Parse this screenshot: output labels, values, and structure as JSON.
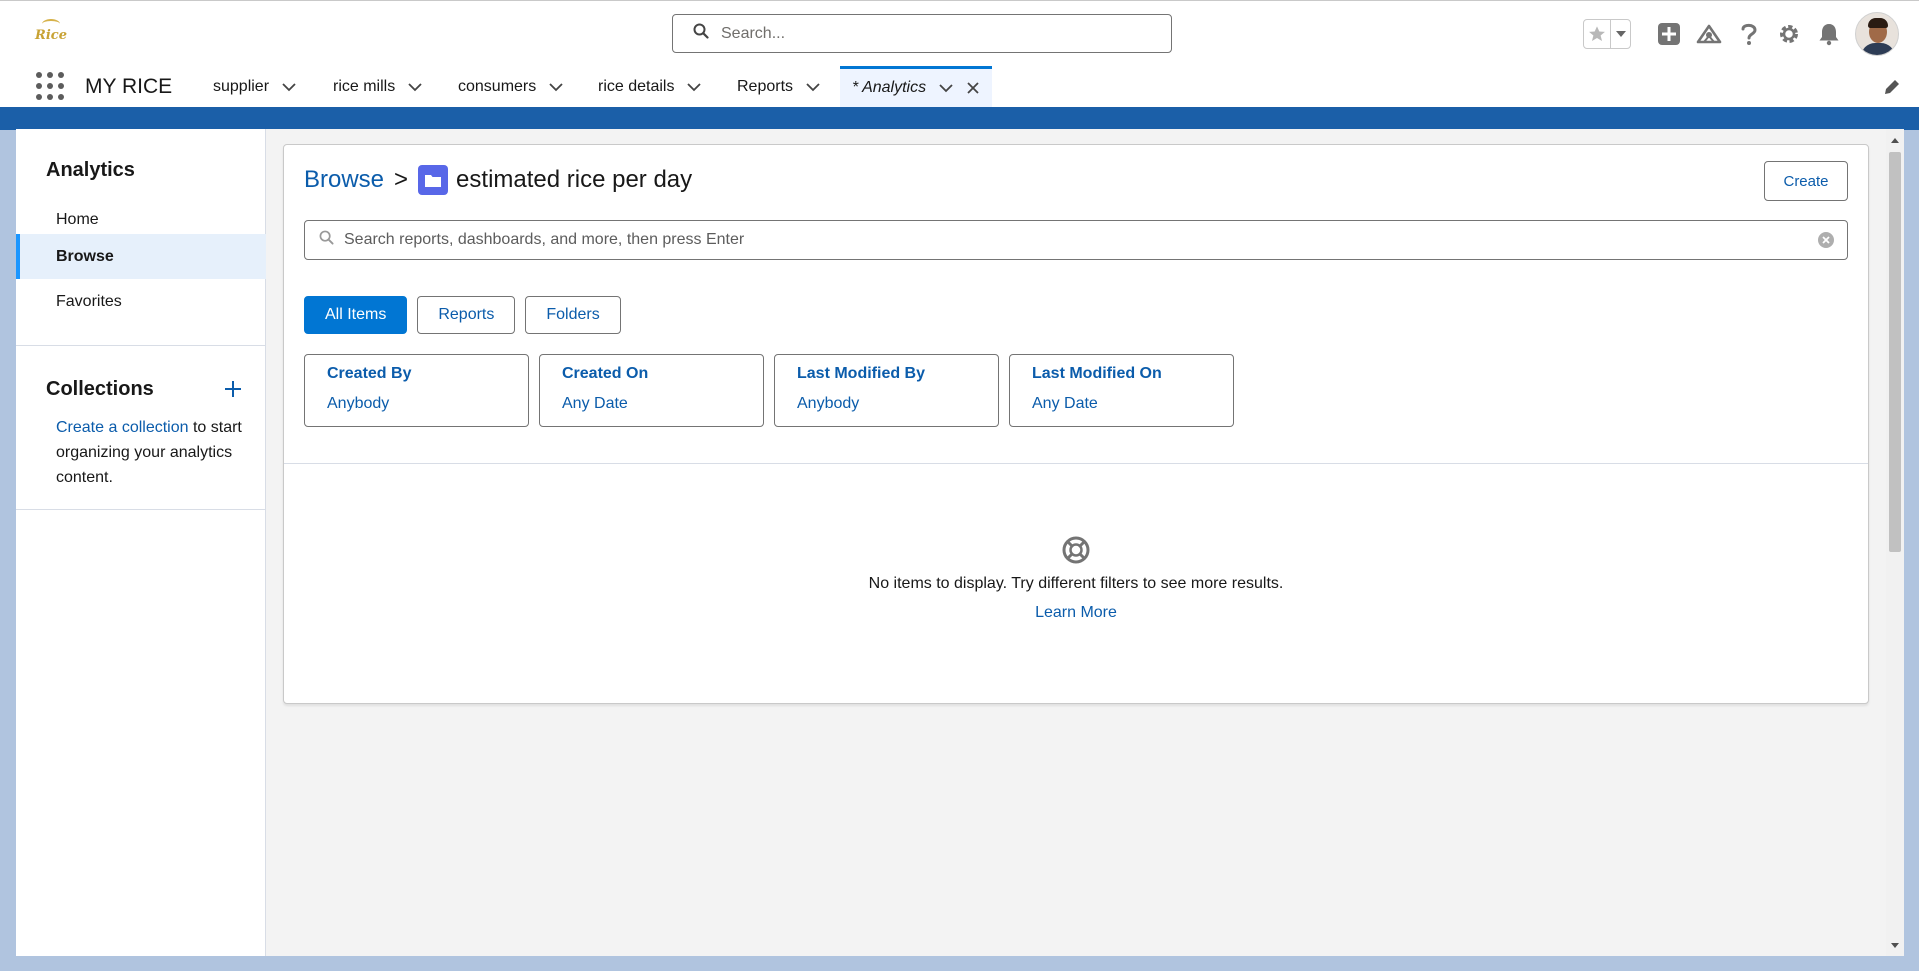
{
  "header": {
    "logo_text": "Rice",
    "search_placeholder": "Search..."
  },
  "navbar": {
    "app_name": "MY RICE",
    "items": [
      {
        "label": "supplier"
      },
      {
        "label": "rice mills"
      },
      {
        "label": "consumers"
      },
      {
        "label": "rice details"
      },
      {
        "label": "Reports"
      }
    ],
    "active_tab": "* Analytics"
  },
  "sidebar": {
    "title": "Analytics",
    "items": [
      {
        "label": "Home"
      },
      {
        "label": "Browse"
      },
      {
        "label": "Favorites"
      }
    ],
    "collections_title": "Collections",
    "collections_link": "Create a collection",
    "collections_text": " to start organizing your analytics content."
  },
  "main": {
    "breadcrumb_root": "Browse",
    "breadcrumb_sep": ">",
    "folder_name": "estimated rice per day",
    "create_label": "Create",
    "search_placeholder": "Search reports, dashboards, and more, then press Enter",
    "tabs": [
      {
        "label": "All Items"
      },
      {
        "label": "Reports"
      },
      {
        "label": "Folders"
      }
    ],
    "filters": [
      {
        "title": "Created By",
        "value": "Anybody"
      },
      {
        "title": "Created On",
        "value": "Any Date"
      },
      {
        "title": "Last Modified By",
        "value": "Anybody"
      },
      {
        "title": "Last Modified On",
        "value": "Any Date"
      }
    ],
    "empty_message": "No items to display. Try different filters to see more results.",
    "learn_more": "Learn More"
  },
  "colors": {
    "brand_blue": "#0176d3",
    "link_blue": "#0b5cab",
    "folder_icon": "#5867e8",
    "nav_band": "#1b5fa8"
  }
}
